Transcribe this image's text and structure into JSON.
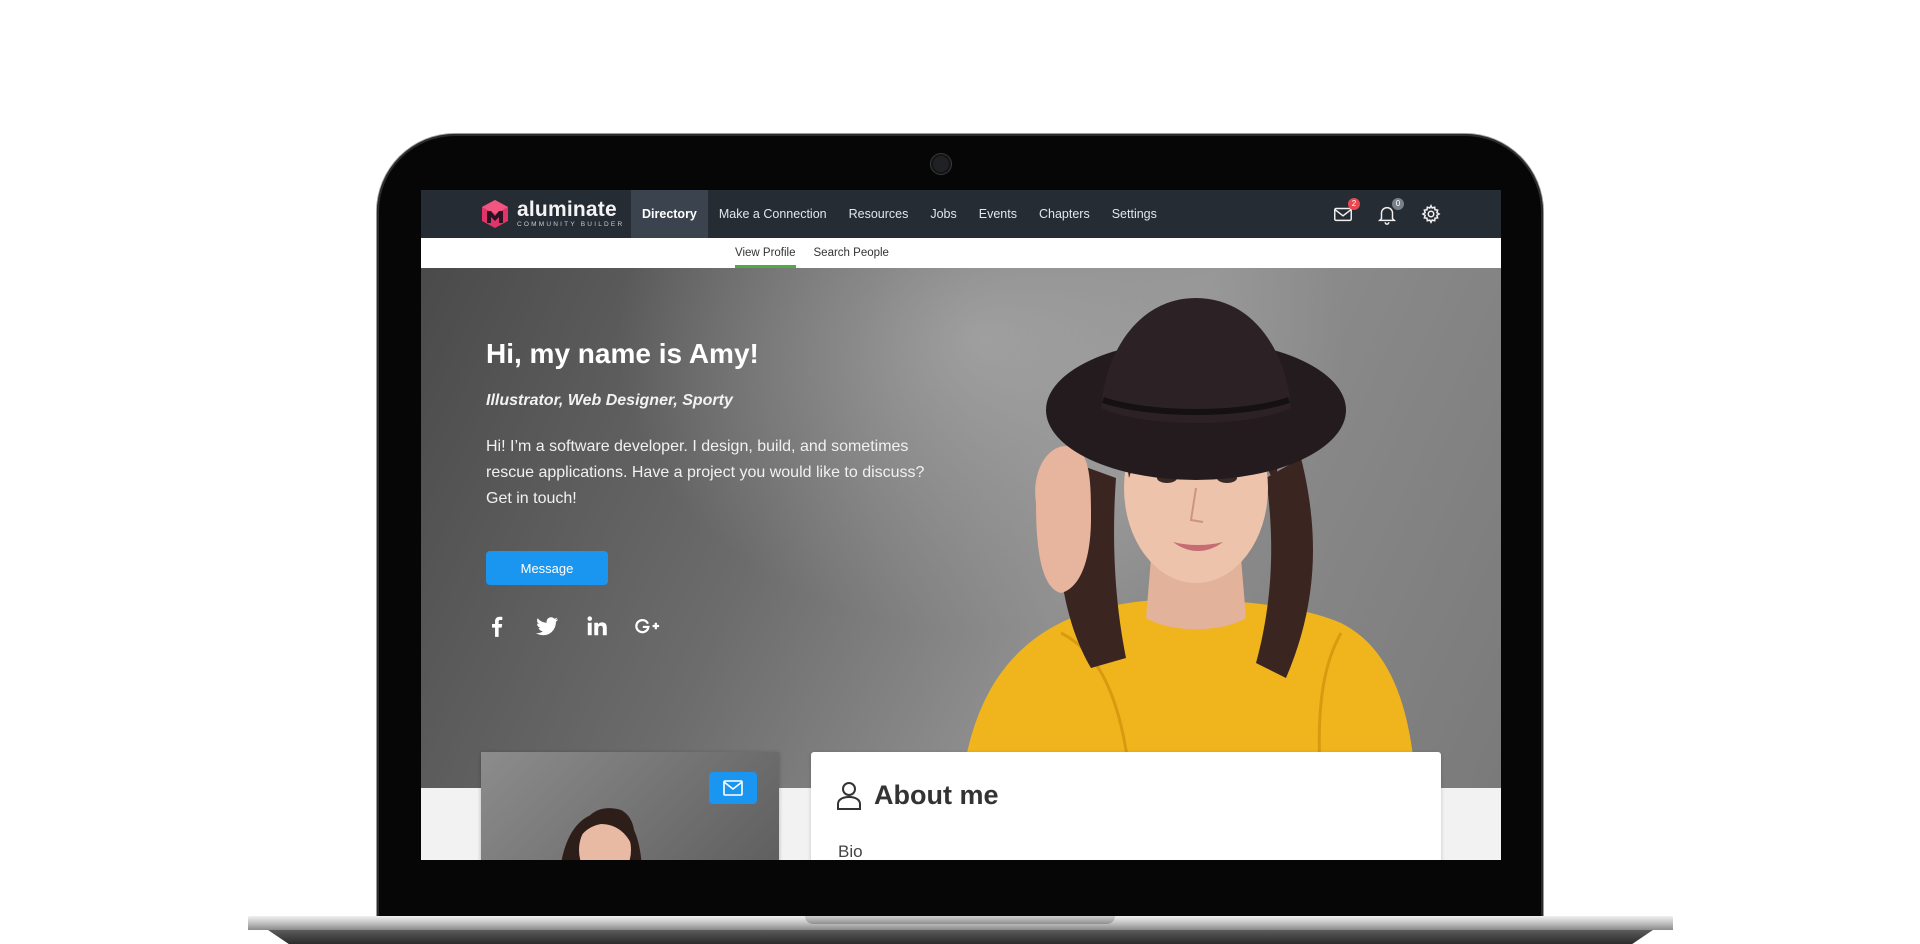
{
  "app": {
    "logo_name": "aluminate",
    "logo_sub": "COMMUNITY BUILDER"
  },
  "nav": {
    "items": [
      {
        "label": "Directory",
        "active": true
      },
      {
        "label": "Make a Connection"
      },
      {
        "label": "Resources"
      },
      {
        "label": "Jobs"
      },
      {
        "label": "Events"
      },
      {
        "label": "Chapters"
      },
      {
        "label": "Settings"
      }
    ],
    "icons": {
      "messages_badge": "2",
      "notifications_badge": "0"
    }
  },
  "subnav": {
    "items": [
      {
        "label": "View Profile",
        "active": true
      },
      {
        "label": "Search People"
      }
    ]
  },
  "hero": {
    "title": "Hi, my name is Amy!",
    "tags": "Illustrator, Web Designer, Sporty",
    "bio": "Hi! I’m a software developer. I design, build, and sometimes rescue applications. Have a project you would like to discuss? Get in touch!",
    "message_label": "Message"
  },
  "socials": [
    "facebook-icon",
    "twitter-icon",
    "linkedin-icon",
    "google-plus-icon"
  ],
  "about": {
    "title": "About me",
    "bio_label": "Bio"
  },
  "colors": {
    "nav_bg": "#262c34",
    "accent_blue": "#1a96f0",
    "active_tab_underline": "#4cae3c",
    "badge_red": "#e8484f",
    "logo_pink": "#e2336b"
  }
}
